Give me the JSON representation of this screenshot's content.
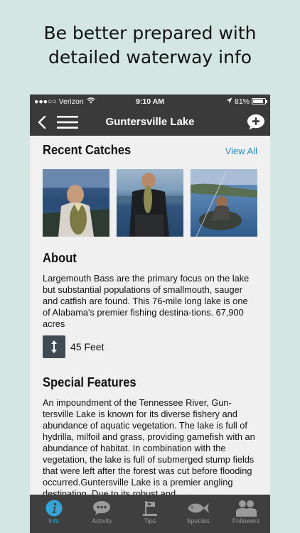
{
  "headline": {
    "line1": "Be better prepared with",
    "line2": "detailed waterway info"
  },
  "status_bar": {
    "carrier": "●●●○○ Verizon",
    "time": "9:10 AM",
    "battery": "81%"
  },
  "nav": {
    "title": "Guntersville Lake"
  },
  "recent_catches": {
    "title": "Recent Catches",
    "view_all": "View All"
  },
  "about": {
    "title": "About",
    "text": "Largemouth Bass are the primary focus on the lake but substantial populations of smallmouth, sauger and catfish are found. This 76-mile long lake is one of Alabama's premier fishing destina-tions. 67,900 acres",
    "depth": "45 Feet"
  },
  "special_features": {
    "title": "Special Features",
    "text": "An impoundment of the Tennessee River, Gun-tersville Lake is known for its diverse fishery and abundance of aquatic vegetation.  The lake is full of hydrilla, milfoil and grass, providing gamefish with an abundance of habitat.  In combination with the vegetation, the lake is full of submerged stump fields that were left after the forest was cut before flooding occurred.Guntersville Lake is a premier angling destination.  Due to its robust and"
  },
  "tabs": [
    {
      "label": "Info",
      "icon": "info-icon",
      "active": true
    },
    {
      "label": "Activity",
      "icon": "chat-bubble-icon",
      "active": false
    },
    {
      "label": "Tips",
      "icon": "flag-icon",
      "active": false
    },
    {
      "label": "Species",
      "icon": "fish-icon",
      "active": false
    },
    {
      "label": "Followers",
      "icon": "people-icon",
      "active": false
    }
  ],
  "colors": {
    "background": "#d3e6e2",
    "bar": "#3a3a3a",
    "accent": "#35a3d8",
    "link": "#2a8cc0"
  }
}
